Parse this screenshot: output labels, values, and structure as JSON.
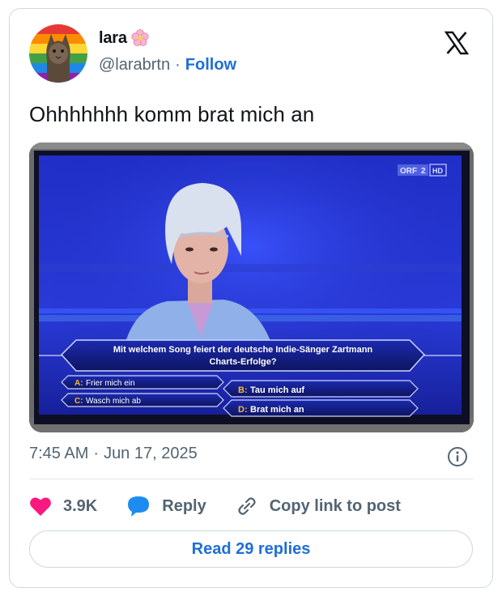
{
  "author": {
    "name": "lara",
    "handle": "@larabrtn",
    "separator": "·",
    "follow_label": "Follow"
  },
  "tweet": {
    "text": "Ohhhhhhh komm brat mich an"
  },
  "media": {
    "channel_logo": "ORF",
    "channel_number": "2",
    "channel_hd": "HD",
    "question_line1": "Mit welchem Song feiert der deutsche Indie-Sänger Zartmann",
    "question_line2": "Charts-Erfolge?",
    "answer_a_letter": "A:",
    "answer_a": "Frier mich ein",
    "answer_b_letter": "B:",
    "answer_b": "Tau mich auf",
    "answer_c_letter": "C:",
    "answer_c": "Wasch mich ab",
    "answer_d_letter": "D:",
    "answer_d": "Brat mich an"
  },
  "meta": {
    "time": "7:45 AM",
    "separator": "·",
    "date": "Jun 17, 2025"
  },
  "actions": {
    "likes": "3.9K",
    "reply_label": "Reply",
    "copy_label": "Copy link to post"
  },
  "footer": {
    "read_replies_label": "Read 29 replies"
  },
  "colors": {
    "accent": "#1d6fd6",
    "like": "#f91880",
    "secondary_text": "#536471",
    "border": "#cfd9de"
  },
  "icons": [
    "x-logo-icon",
    "flower-emoji-icon",
    "info-icon",
    "heart-icon",
    "reply-bubble-icon",
    "link-icon"
  ]
}
